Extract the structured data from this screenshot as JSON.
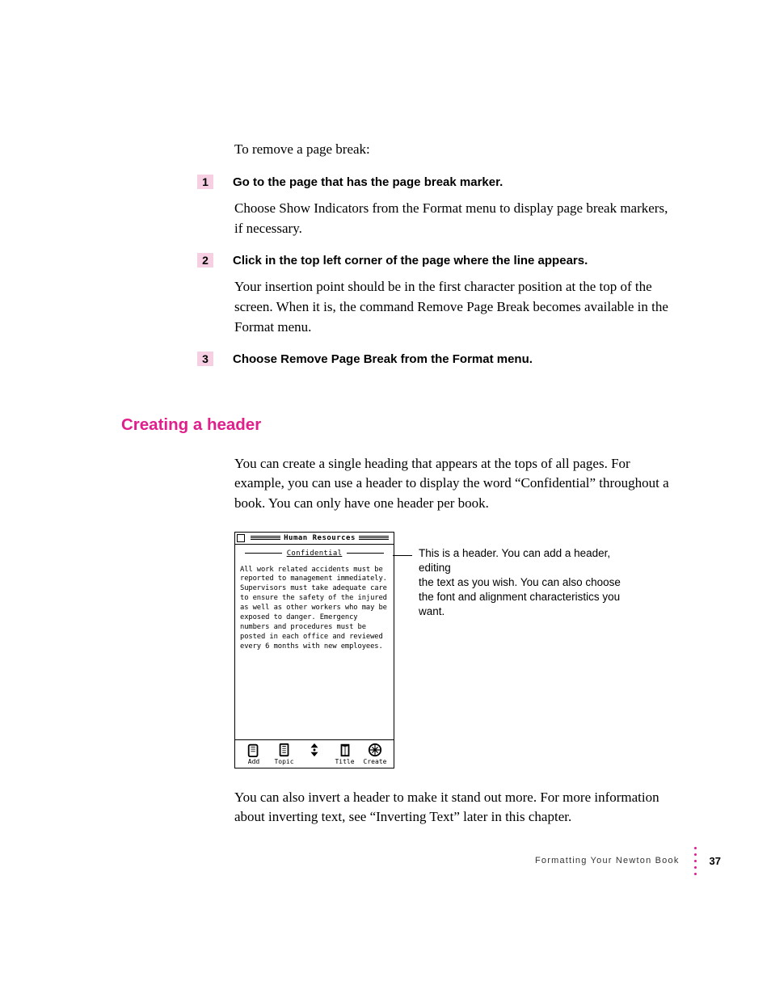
{
  "intro_small": "To remove a page break:",
  "steps": [
    {
      "num": "1",
      "title": "Go to the page that has the page break marker.",
      "body": "Choose Show Indicators from the Format menu to display page break markers, if necessary."
    },
    {
      "num": "2",
      "title": "Click in the top left corner of the page where the line appears.",
      "body": "Your insertion point should be in the first character position at the top of the screen. When it is, the command Remove Page Break becomes available in the Format menu."
    },
    {
      "num": "3",
      "title": "Choose Remove Page Break from the Format menu.",
      "body": ""
    }
  ],
  "section_heading": "Creating a header",
  "header_intro": "You can create a single heading that appears at the tops of all pages. For example, you can use a header to display the word “Confidential” throughout a book. You can only have one header per book.",
  "illustration": {
    "window_title": "Human Resources",
    "header_text": "Confidential",
    "body_text": "All work related accidents must be reported to management immediately. Supervisors must take adequate care to ensure the safety of the injured as well as other workers who may be exposed to danger. Emergency numbers and procedures must be posted in each office and reviewed every 6 months with new employees.",
    "toolbar": {
      "add": "Add",
      "topic": "Topic",
      "arrows": "",
      "title": "Title",
      "create": "Create"
    }
  },
  "callout": {
    "line1": "This is a header. You can add a header, editing",
    "line2": "the text as you wish. You can also choose",
    "line3": "the font and alignment characteristics you want."
  },
  "post_illust": "You can also invert a header to make it stand out more. For more information about inverting text, see “Inverting Text” later in this chapter.",
  "footer": {
    "section": "Formatting Your Newton Book",
    "page": "37"
  }
}
